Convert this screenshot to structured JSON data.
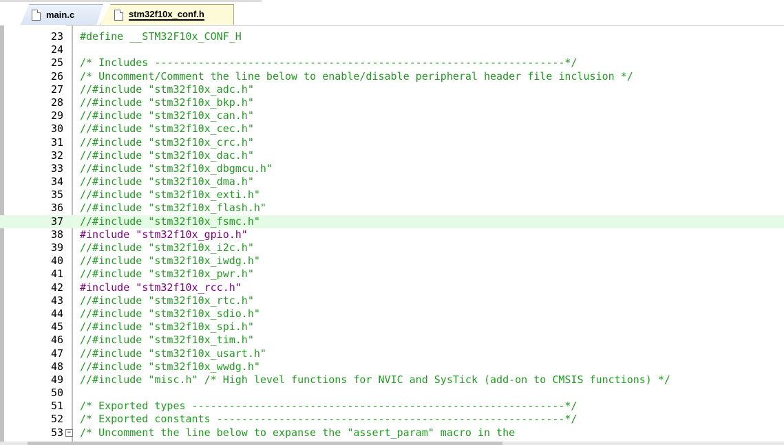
{
  "tabs": [
    {
      "label": "main.c",
      "active": false
    },
    {
      "label": "stm32f10x_conf.h",
      "active": true
    }
  ],
  "colors": {
    "comment": "#229922",
    "preprocessor": "#800080",
    "highlight_line": "#e6fbe6"
  },
  "editor": {
    "highlighted_line": 37,
    "lines": [
      {
        "num": "23",
        "text": "#define __STM32F10x_CONF_H",
        "kind": "comment"
      },
      {
        "num": "24",
        "text": "",
        "kind": "normal"
      },
      {
        "num": "25",
        "text": "/* Includes ------------------------------------------------------------------*/",
        "kind": "comment"
      },
      {
        "num": "26",
        "text": "/* Uncomment/Comment the line below to enable/disable peripheral header file inclusion */",
        "kind": "comment"
      },
      {
        "num": "27",
        "text": "//#include \"stm32f10x_adc.h\"",
        "kind": "comment"
      },
      {
        "num": "28",
        "text": "//#include \"stm32f10x_bkp.h\"",
        "kind": "comment"
      },
      {
        "num": "29",
        "text": "//#include \"stm32f10x_can.h\"",
        "kind": "comment"
      },
      {
        "num": "30",
        "text": "//#include \"stm32f10x_cec.h\"",
        "kind": "comment"
      },
      {
        "num": "31",
        "text": "//#include \"stm32f10x_crc.h\"",
        "kind": "comment"
      },
      {
        "num": "32",
        "text": "//#include \"stm32f10x_dac.h\"",
        "kind": "comment"
      },
      {
        "num": "33",
        "text": "//#include \"stm32f10x_dbgmcu.h\"",
        "kind": "comment"
      },
      {
        "num": "34",
        "text": "//#include \"stm32f10x_dma.h\"",
        "kind": "comment"
      },
      {
        "num": "35",
        "text": "//#include \"stm32f10x_exti.h\"",
        "kind": "comment"
      },
      {
        "num": "36",
        "text": "//#include \"stm32f10x_flash.h\"",
        "kind": "comment"
      },
      {
        "num": "37",
        "text": "//#include \"stm32f10x_fsmc.h\"",
        "kind": "comment"
      },
      {
        "num": "38",
        "text": "#include \"stm32f10x_gpio.h\"",
        "kind": "pre"
      },
      {
        "num": "39",
        "text": "//#include \"stm32f10x_i2c.h\"",
        "kind": "comment"
      },
      {
        "num": "40",
        "text": "//#include \"stm32f10x_iwdg.h\"",
        "kind": "comment"
      },
      {
        "num": "41",
        "text": "//#include \"stm32f10x_pwr.h\"",
        "kind": "comment"
      },
      {
        "num": "42",
        "text": "#include \"stm32f10x_rcc.h\"",
        "kind": "pre"
      },
      {
        "num": "43",
        "text": "//#include \"stm32f10x_rtc.h\"",
        "kind": "comment"
      },
      {
        "num": "44",
        "text": "//#include \"stm32f10x_sdio.h\"",
        "kind": "comment"
      },
      {
        "num": "45",
        "text": "//#include \"stm32f10x_spi.h\"",
        "kind": "comment"
      },
      {
        "num": "46",
        "text": "//#include \"stm32f10x_tim.h\"",
        "kind": "comment"
      },
      {
        "num": "47",
        "text": "//#include \"stm32f10x_usart.h\"",
        "kind": "comment"
      },
      {
        "num": "48",
        "text": "//#include \"stm32f10x_wwdg.h\"",
        "kind": "comment"
      },
      {
        "num": "49",
        "text": "//#include \"misc.h\" /* High level functions for NVIC and SysTick (add-on to CMSIS functions) */",
        "kind": "comment"
      },
      {
        "num": "50",
        "text": "",
        "kind": "normal"
      },
      {
        "num": "51",
        "text": "/* Exported types ------------------------------------------------------------*/",
        "kind": "comment"
      },
      {
        "num": "52",
        "text": "/* Exported constants --------------------------------------------------------*/",
        "kind": "comment"
      },
      {
        "num": "53",
        "text": "/* Uncomment the line below to expanse the \"assert_param\" macro in the",
        "kind": "comment",
        "fold": "minus-icon"
      }
    ]
  }
}
